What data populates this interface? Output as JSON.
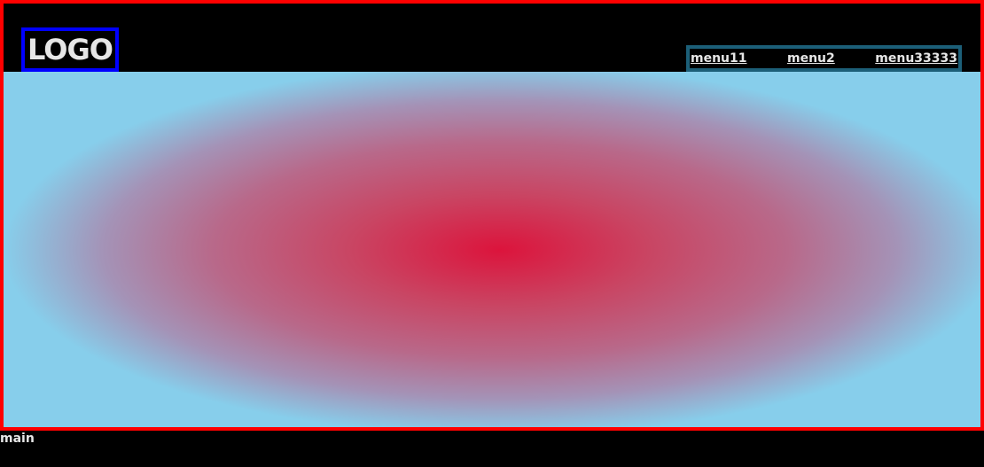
{
  "header": {
    "logo_text": "LOGO",
    "menu": [
      {
        "label": "menu11"
      },
      {
        "label": "menu2"
      },
      {
        "label": "menu33333"
      }
    ]
  },
  "main": {
    "label": "main"
  },
  "colors": {
    "frame_border": "#ff0000",
    "logo_border": "#0000ff",
    "menu_border": "#1c5f78",
    "gradient_center": "#dc143c",
    "gradient_edge": "#87ceeb",
    "background": "#000000",
    "text": "#e6e6e6"
  }
}
